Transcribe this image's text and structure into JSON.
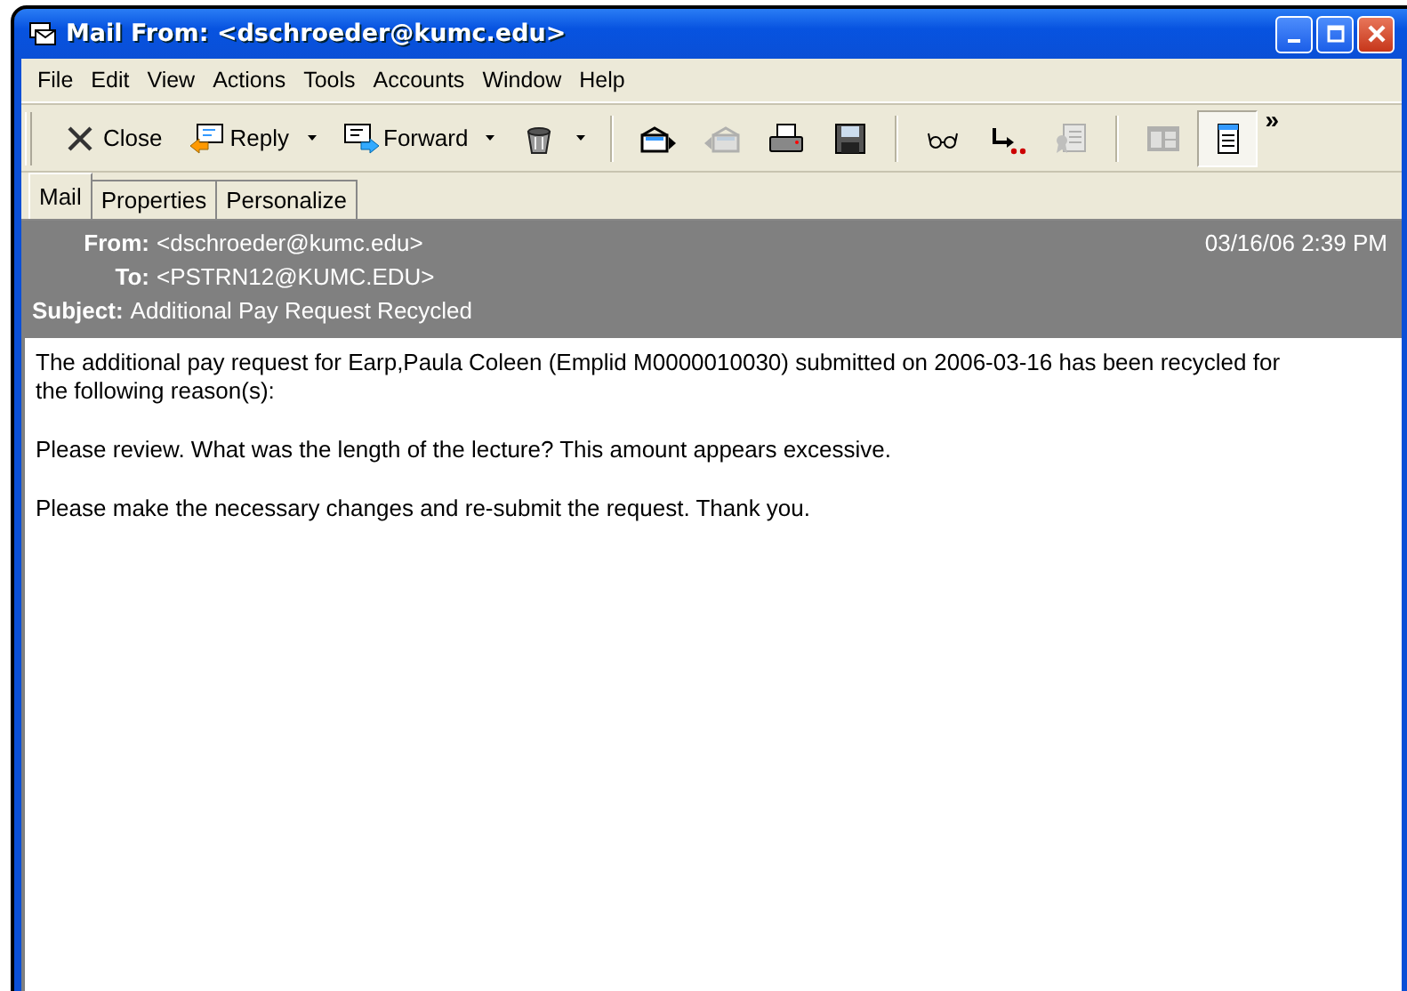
{
  "window": {
    "title": "Mail From: <dschroeder@kumc.edu>"
  },
  "menu": [
    "File",
    "Edit",
    "View",
    "Actions",
    "Tools",
    "Accounts",
    "Window",
    "Help"
  ],
  "toolbar": [
    {
      "kind": "close",
      "label": "Close",
      "dropdown": false,
      "disabled": false,
      "pressed": false
    },
    {
      "kind": "reply",
      "label": "Reply",
      "dropdown": true,
      "disabled": false,
      "pressed": false
    },
    {
      "kind": "forward",
      "label": "Forward",
      "dropdown": true,
      "disabled": false,
      "pressed": false
    },
    {
      "kind": "trash",
      "dropdown": true,
      "disabled": false,
      "pressed": false
    },
    {
      "kind": "separator"
    },
    {
      "kind": "next",
      "dropdown": false,
      "disabled": false,
      "pressed": false
    },
    {
      "kind": "previous",
      "dropdown": false,
      "disabled": true,
      "pressed": false
    },
    {
      "kind": "print",
      "dropdown": false,
      "disabled": false,
      "pressed": false
    },
    {
      "kind": "save",
      "dropdown": false,
      "disabled": false,
      "pressed": false
    },
    {
      "kind": "separator"
    },
    {
      "kind": "glasses",
      "dropdown": false,
      "disabled": false,
      "pressed": false
    },
    {
      "kind": "route",
      "dropdown": false,
      "disabled": false,
      "pressed": false
    },
    {
      "kind": "certificate",
      "dropdown": false,
      "disabled": true,
      "pressed": false
    },
    {
      "kind": "separator"
    },
    {
      "kind": "layout",
      "dropdown": false,
      "disabled": true,
      "pressed": false
    },
    {
      "kind": "document",
      "dropdown": false,
      "disabled": false,
      "pressed": true
    }
  ],
  "toolbar_overflow": "»",
  "tabs": [
    {
      "label": "Mail",
      "selected": true
    },
    {
      "label": "Properties",
      "selected": false
    },
    {
      "label": "Personalize",
      "selected": false
    }
  ],
  "header": {
    "from_label": "From:",
    "from": "<dschroeder@kumc.edu>",
    "date": "03/16/06 2:39 PM",
    "to_label": "To:",
    "to": "<PSTRN12@KUMC.EDU>",
    "subject_label": "Subject:",
    "subject": "Additional Pay Request Recycled"
  },
  "body": [
    "The additional pay request for Earp,Paula Coleen (Emplid M0000010030) submitted on 2006-03-16 has been recycled for the following reason(s):",
    "Please review.  What was the length of the lecture?  This amount appears excessive.",
    "Please make the necessary changes and re-submit the request. Thank you."
  ]
}
